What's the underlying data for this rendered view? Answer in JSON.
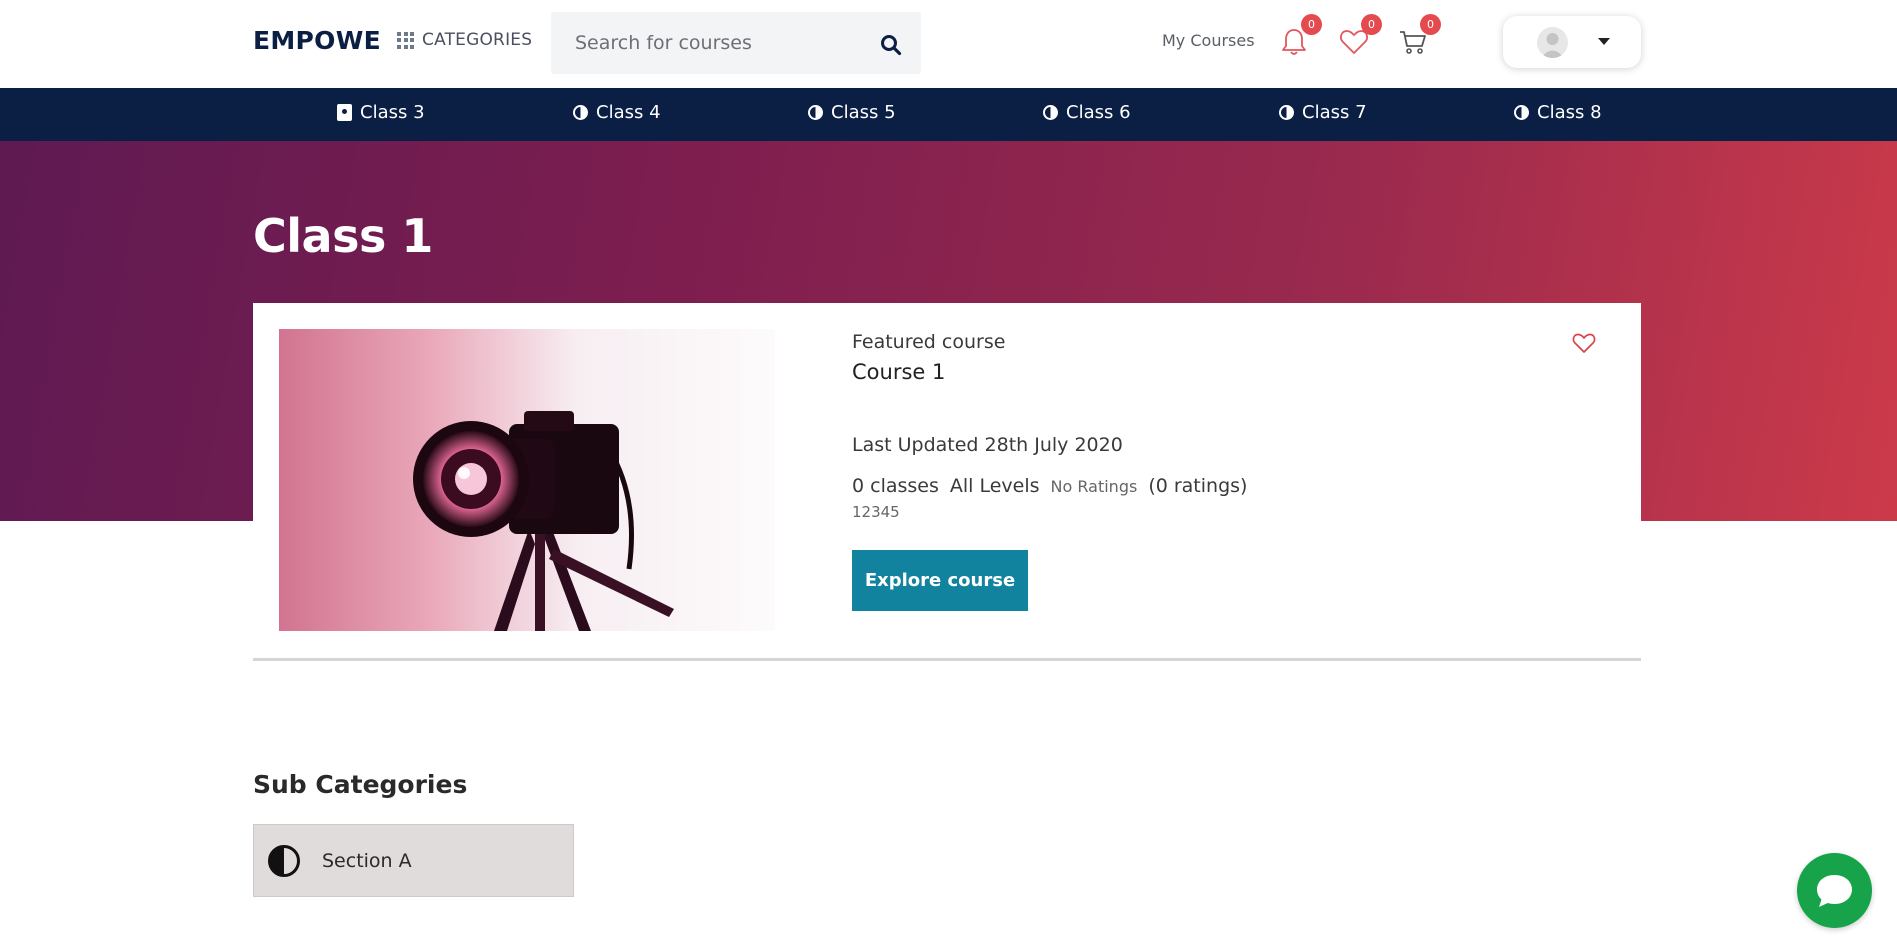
{
  "header": {
    "logo": "EMPOWE",
    "categories_label": "CATEGORIES",
    "search_placeholder": "Search for courses",
    "my_courses_label": "My Courses",
    "notifications_count": "0",
    "wishlist_count": "0",
    "cart_count": "0"
  },
  "navbar": {
    "items": [
      {
        "label": "Class 3",
        "icon": "contact-book-icon"
      },
      {
        "label": "Class 4",
        "icon": "half-circle-icon"
      },
      {
        "label": "Class 5",
        "icon": "half-circle-icon"
      },
      {
        "label": "Class 6",
        "icon": "half-circle-icon"
      },
      {
        "label": "Class 7",
        "icon": "half-circle-icon"
      },
      {
        "label": "Class 8",
        "icon": "half-circle-icon"
      }
    ]
  },
  "hero": {
    "title": "Class 1"
  },
  "featured": {
    "label": "Featured course",
    "course_title": "Course 1",
    "last_updated": "Last Updated 28th July 2020",
    "classes": "0 classes",
    "level": "All Levels",
    "ratings_text": "No Ratings",
    "ratings_count": "(0 ratings)",
    "code": "12345",
    "button_label": "Explore course"
  },
  "subcategories": {
    "heading": "Sub Categories",
    "items": [
      {
        "label": "Section A",
        "icon": "half-circle-icon"
      }
    ]
  },
  "colors": {
    "navy": "#0b1f44",
    "accent": "#11839e",
    "badge": "#e34b4f",
    "chat": "#16a34a"
  }
}
